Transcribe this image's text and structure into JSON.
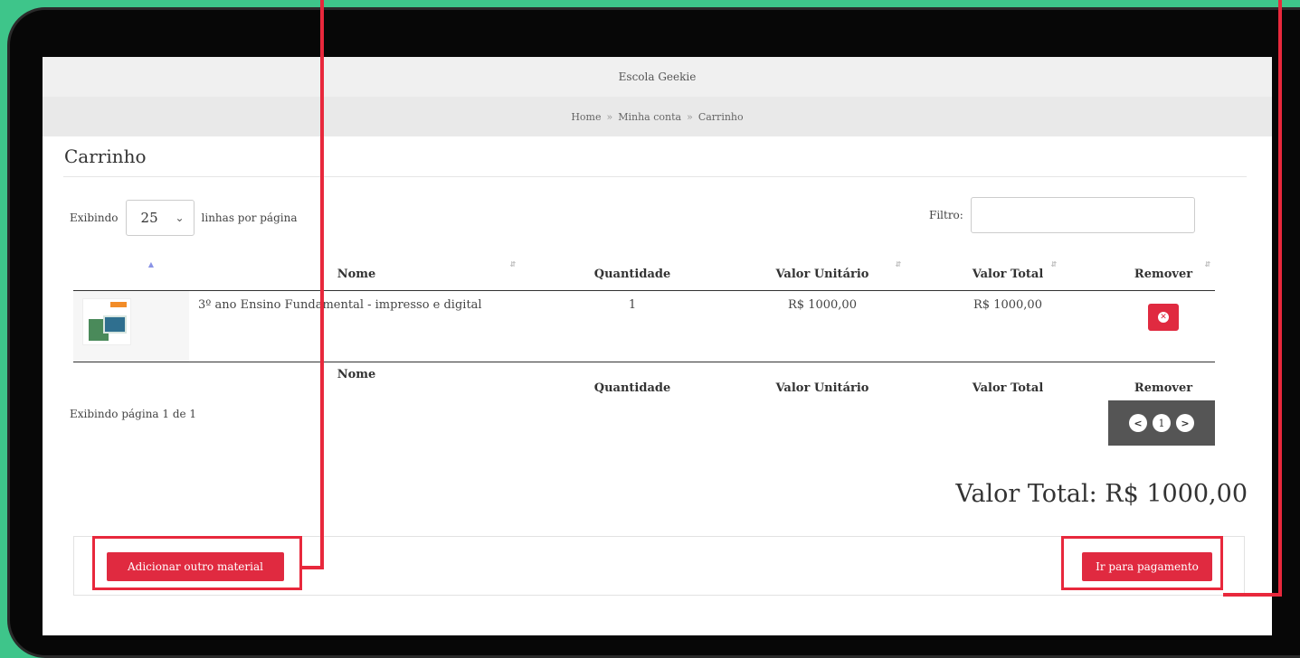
{
  "header": {
    "site_title": "Escola Geekie"
  },
  "breadcrumb": {
    "items": [
      "Home",
      "Minha conta",
      "Carrinho"
    ],
    "separator": "»"
  },
  "page": {
    "title": "Carrinho"
  },
  "table_controls": {
    "length_prefix": "Exibindo",
    "length_value": "25",
    "length_suffix": "linhas por página",
    "filter_label": "Filtro:",
    "filter_value": ""
  },
  "table": {
    "columns": [
      "Nome",
      "Quantidade",
      "Valor Unitário",
      "Valor Total",
      "Remover"
    ],
    "rows": [
      {
        "name": "3º ano Ensino Fundamental - impresso e digital",
        "quantity": "1",
        "unit_price": "R$ 1000,00",
        "total_price": "R$ 1000,00"
      }
    ]
  },
  "pagination": {
    "info": "Exibindo página 1 de 1",
    "prev": "<",
    "current": "1",
    "next": ">"
  },
  "summary": {
    "total": "Valor Total: R$ 1000,00"
  },
  "actions": {
    "add_material": "Adicionar outro material",
    "go_to_payment": "Ir para pagamento"
  },
  "colors": {
    "accent": "#e02a40",
    "background": "#3ec58a",
    "annotation": "#e8283c"
  }
}
